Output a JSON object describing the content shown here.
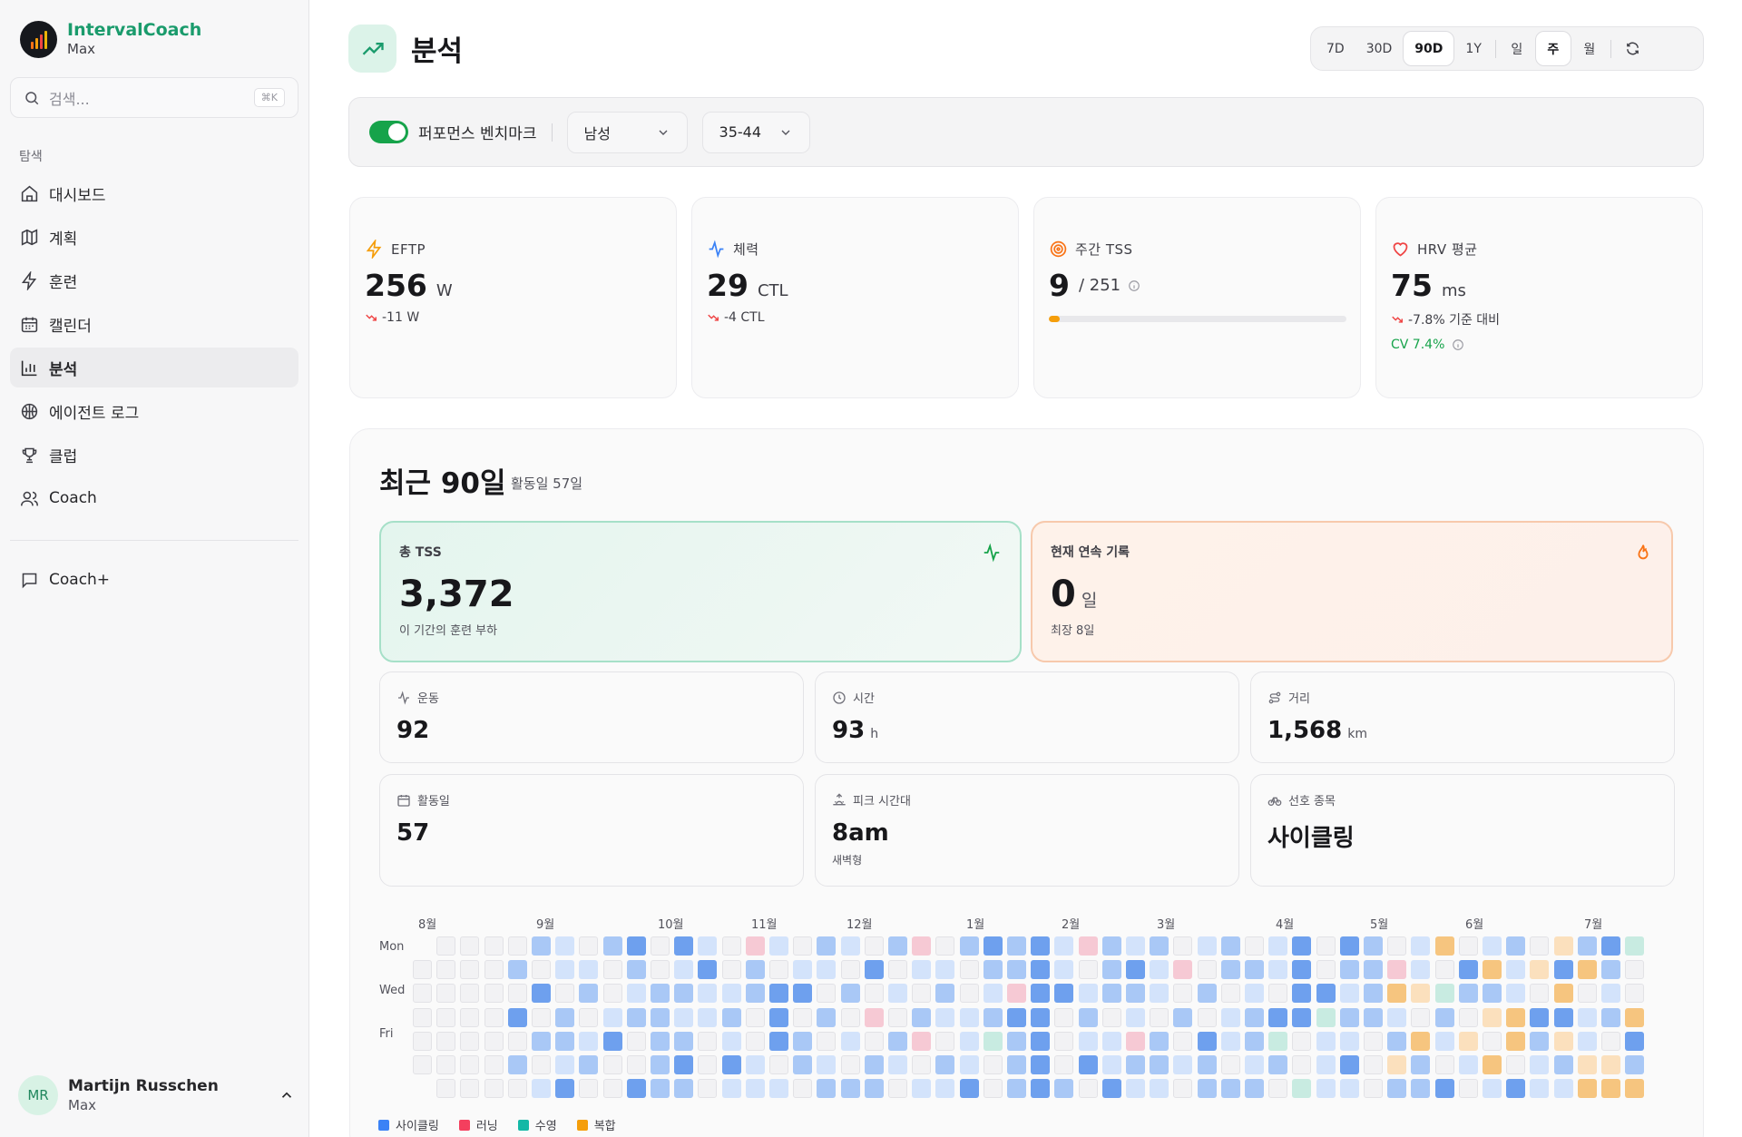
{
  "brand": {
    "name": "IntervalCoach",
    "sub": "Max"
  },
  "search": {
    "placeholder": "검색...",
    "shortcut": "⌘K"
  },
  "sidebar": {
    "section": "탐색",
    "items": [
      {
        "label": "대시보드",
        "icon": "home-icon"
      },
      {
        "label": "계획",
        "icon": "map-icon"
      },
      {
        "label": "훈련",
        "icon": "bolt-icon"
      },
      {
        "label": "캘린더",
        "icon": "calendar-icon"
      },
      {
        "label": "분석",
        "icon": "bar-chart-icon",
        "active": true
      },
      {
        "label": "에이전트 로그",
        "icon": "brain-icon"
      },
      {
        "label": "클럽",
        "icon": "trophy-icon"
      },
      {
        "label": "Coach",
        "icon": "users-icon"
      }
    ],
    "extra": {
      "label": "Coach+",
      "icon": "message-icon"
    }
  },
  "user": {
    "initials": "MR",
    "name": "Martijn Russchen",
    "plan": "Max"
  },
  "header": {
    "title": "분석"
  },
  "range": {
    "periods": [
      "7D",
      "30D",
      "90D",
      "1Y"
    ],
    "active_period": "90D",
    "granularity": [
      "일",
      "주",
      "월"
    ],
    "active_granularity": "주"
  },
  "benchmark": {
    "label": "퍼포먼스 벤치마크",
    "enabled": true,
    "gender": "남성",
    "age": "35-44"
  },
  "stats": [
    {
      "label": "EFTP",
      "value": "256",
      "unit": "W",
      "delta": "-11 W"
    },
    {
      "label": "체력",
      "value": "29",
      "unit": "CTL",
      "delta": "-4 CTL"
    },
    {
      "label": "주간 TSS",
      "value": "9",
      "unit": "/ 251",
      "progress": 0.036
    },
    {
      "label": "HRV 평균",
      "value": "75",
      "unit": "ms",
      "delta": "-7.8% 기준 대비",
      "cv": "CV 7.4%"
    }
  ],
  "summary": {
    "title": "최근 90일",
    "subtitle": "활동일 57일",
    "total_tss": {
      "label": "총 TSS",
      "value": "3,372",
      "desc": "이 기간의 훈련 부하"
    },
    "streak": {
      "label": "현재 연속 기록",
      "value": "0",
      "unit": "일",
      "desc": "최장 8일"
    },
    "workouts": {
      "label": "운동",
      "value": "92"
    },
    "time": {
      "label": "시간",
      "value": "93",
      "unit": "h"
    },
    "distance": {
      "label": "거리",
      "value": "1,568",
      "unit": "km"
    },
    "active_days": {
      "label": "활동일",
      "value": "57"
    },
    "peak_time": {
      "label": "피크 시간대",
      "value": "8am",
      "desc": "새벽형"
    },
    "favorite": {
      "label": "선호 종목",
      "value": "사이클링"
    }
  },
  "heatmap": {
    "months": [
      "8월",
      "9월",
      "10월",
      "11월",
      "12월",
      "1월",
      "2월",
      "3월",
      "4월",
      "5월",
      "6월",
      "7월"
    ],
    "days": [
      "Mon",
      "Wed",
      "Fri"
    ],
    "colors": {
      "empty": "#f2f2f4",
      "cycling1": "#d3e3fb",
      "cycling2": "#a9c8f6",
      "cycling3": "#6ea0ee",
      "running": "#f6c9d4",
      "swim": "#c8ebe1",
      "multi1": "#fbe0bd",
      "multi2": "#f6c57f"
    },
    "legend": [
      {
        "label": "사이클링",
        "color": "#3b82f6"
      },
      {
        "label": "러닝",
        "color": "#f43f5e"
      },
      {
        "label": "수영",
        "color": "#14b8a6"
      },
      {
        "label": "복합",
        "color": "#f59e0b"
      }
    ]
  }
}
